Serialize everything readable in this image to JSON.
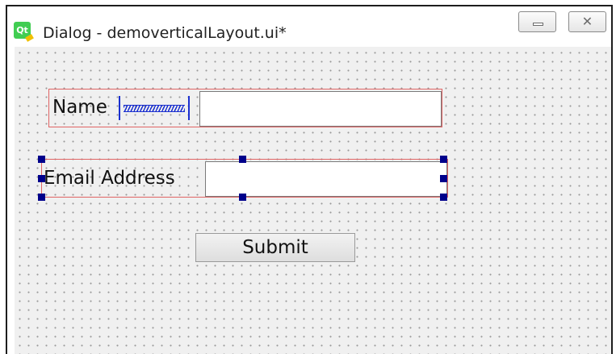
{
  "window": {
    "title": "Dialog - demoverticalLayout.ui*",
    "logo_text": "Qt",
    "minimize_glyph": "",
    "close_glyph": "✕"
  },
  "form": {
    "name_label": "Name",
    "name_value": "",
    "email_label": "Email Address",
    "email_value": "",
    "submit_label": "Submit"
  },
  "colors": {
    "layout_border": "#e06464",
    "selection_handle": "#00008b",
    "spacer": "#1a2fd0",
    "canvas_background": "#f0f0f0"
  },
  "icons": {
    "app": "qt-logo-icon",
    "minimize": "minimize-icon",
    "close": "close-icon",
    "spacer": "horizontal-spacer-icon"
  }
}
